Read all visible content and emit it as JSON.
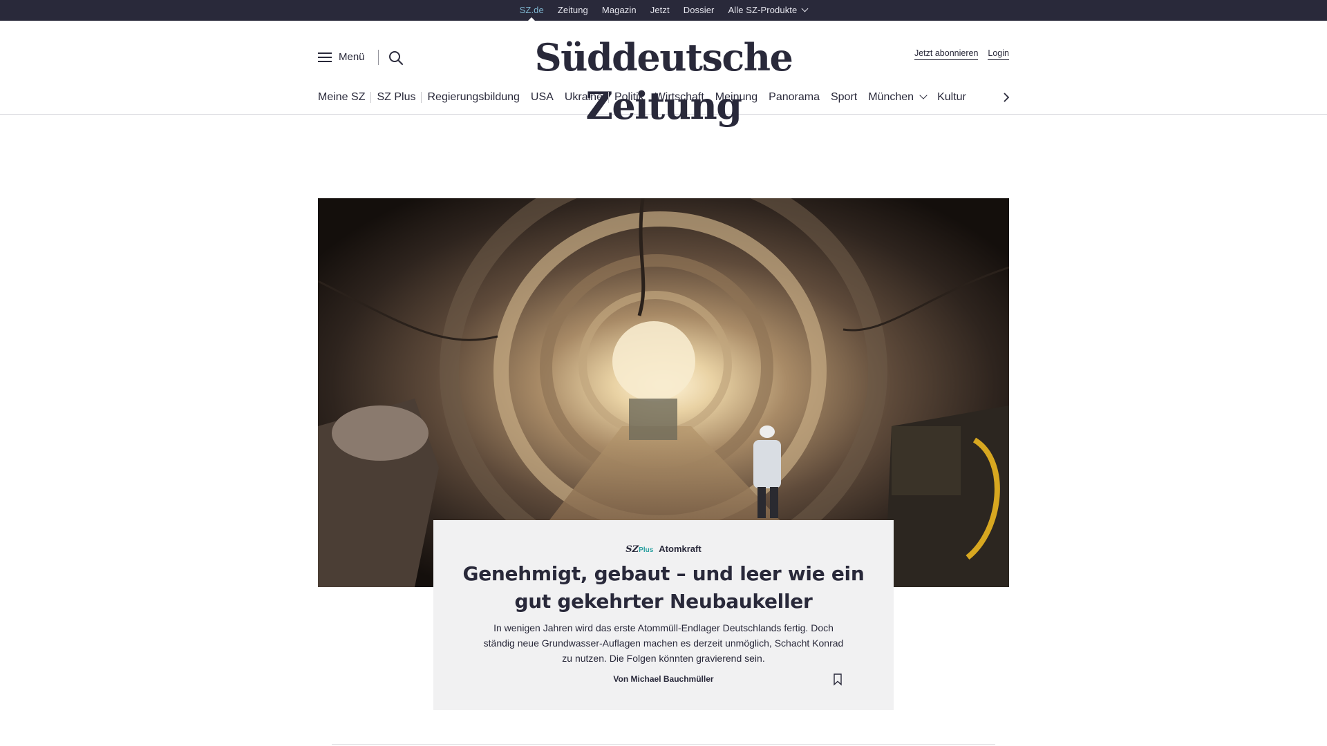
{
  "topbar": {
    "links": [
      "SZ.de",
      "Zeitung",
      "Magazin",
      "Jetzt",
      "Dossier",
      "Alle SZ-Produkte"
    ]
  },
  "header": {
    "menu_label": "Menü",
    "logo_text": "Süddeutsche Zeitung",
    "subscribe_label": "Jetzt abonnieren",
    "login_label": "Login"
  },
  "nav": {
    "items": [
      "Meine SZ",
      "SZ Plus",
      "Regierungsbildung",
      "USA",
      "Ukraine",
      "Politik",
      "Wirtschaft",
      "Meinung",
      "Panorama",
      "Sport",
      "München",
      "Kultur"
    ]
  },
  "article": {
    "badge_sz": "SZ",
    "badge_plus": "Plus",
    "kicker": "Atomkraft",
    "headline": "Genehmigt, gebaut – und leer wie ein gut gekehrter Neubaukeller",
    "teaser": "In wenigen Jahren wird das erste Atommüll-Endlager Deutschlands fertig. Doch ständig neue Grundwasser-Auflagen machen es derzeit unmöglich, Schacht Konrad zu nutzen. Die Folgen könnten gravierend sein.",
    "byline": "Von Michael Bauchmüller"
  },
  "colors": {
    "dark": "#29293a",
    "accent_active": "#7fb6d1",
    "plus_teal": "#2aa0a0",
    "card_bg": "#f1f1f2"
  }
}
